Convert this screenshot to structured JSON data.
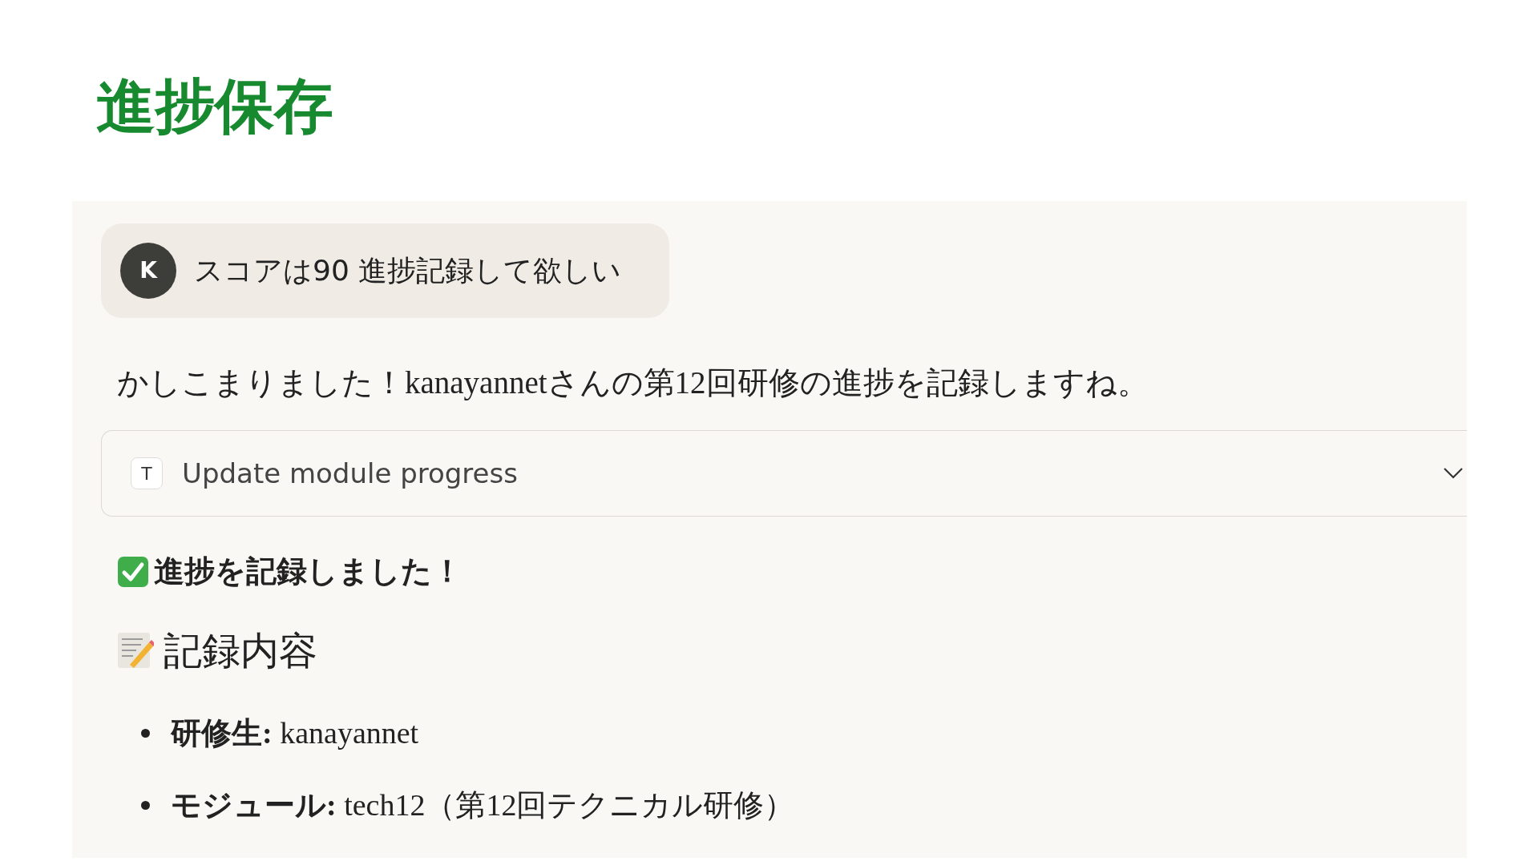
{
  "title": "進捗保存",
  "user_message": {
    "avatar": "K",
    "text": "スコアは90 進捗記録して欲しい"
  },
  "response": {
    "intro": "かしこまりました！kanayannetさんの第12回研修の進捗を記録しますね。",
    "tool_call": {
      "badge": "T",
      "label": "Update module progress",
      "expanded": false
    },
    "status": "進捗を記録しました！",
    "section_heading": "記録内容",
    "items": [
      {
        "text": "**研修生:** kanayannet"
      },
      {
        "text": "**モジュール:** tech12（第12回テクニカル研修）"
      }
    ]
  }
}
